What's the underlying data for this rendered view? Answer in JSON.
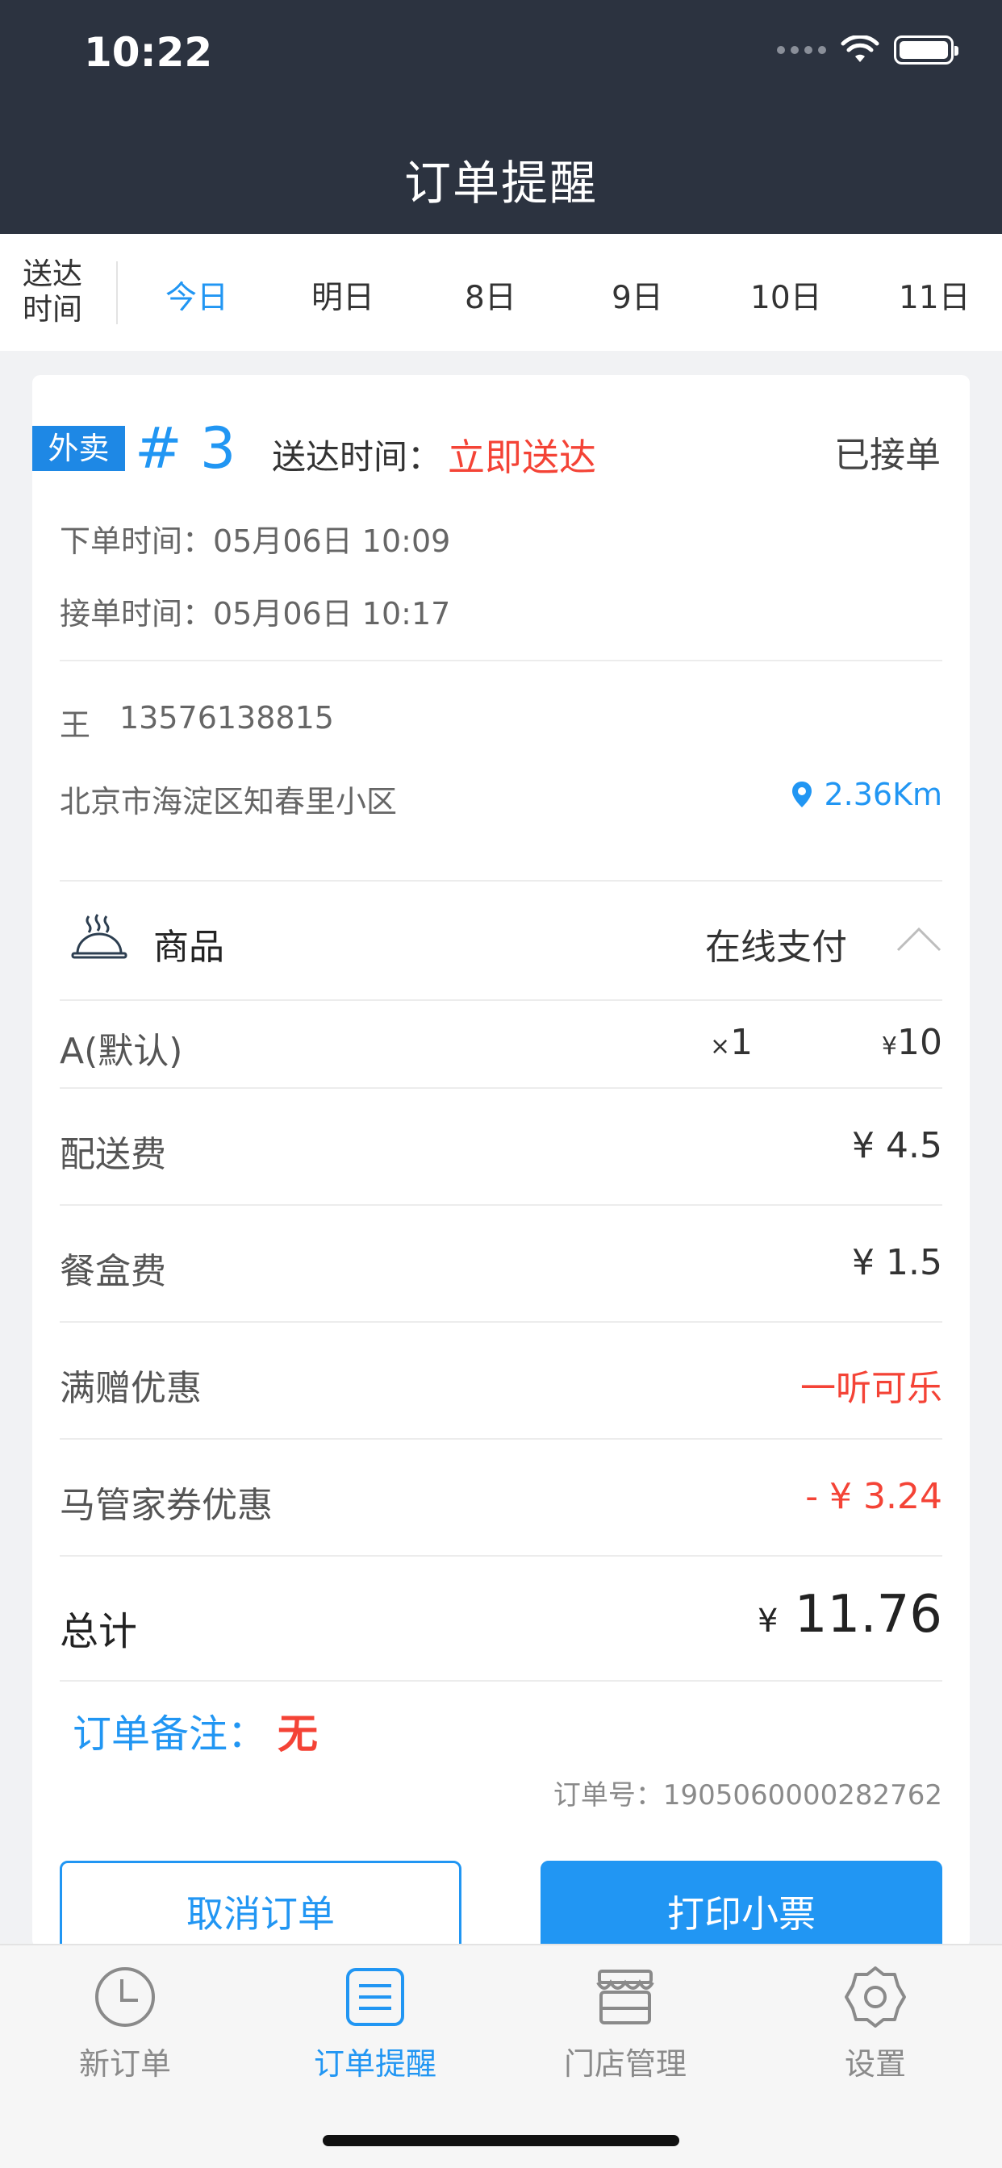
{
  "status_bar": {
    "time": "10:22"
  },
  "header": {
    "title": "订单提醒"
  },
  "date_bar": {
    "label": "送达时间",
    "tabs": [
      "今日",
      "明日",
      "8日",
      "9日",
      "10日",
      "11日"
    ],
    "active_index": 0
  },
  "order": {
    "type_badge": "外卖",
    "number": "# 3",
    "deliver_label": "送达时间：",
    "deliver_value": "立即送达",
    "status": "已接单",
    "placed_time": "下单时间：05月06日 10:09",
    "accepted_time": "接单时间：05月06日 10:17",
    "customer_name": "王",
    "customer_phone": "13576138815",
    "address": "北京市海淀区知春里小区",
    "distance": "2.36Km",
    "goods_title": "商品",
    "payment": "在线支付",
    "item": {
      "name": "A(默认)",
      "qty_prefix": "×",
      "qty": "1",
      "price_symbol": "¥",
      "price": "10"
    },
    "fees": [
      {
        "label": "配送费",
        "value": "¥ 4.5"
      },
      {
        "label": "餐盒费",
        "value": "¥ 1.5"
      },
      {
        "label": "满赠优惠",
        "value": "一听可乐"
      },
      {
        "label": "马管家券优惠",
        "value": "- ¥ 3.24"
      }
    ],
    "total_label": "总计",
    "total_symbol": "¥",
    "total_value": "11.76",
    "note_label": "订单备注：",
    "note_value": "无",
    "order_number": "订单号：1905060000282762",
    "cancel_button": "取消订单",
    "print_button": "打印小票"
  },
  "tabbar": {
    "items": [
      "新订单",
      "订单提醒",
      "门店管理",
      "设置"
    ],
    "active_index": 1
  },
  "colors": {
    "accent": "#2196f3",
    "danger": "#f44336",
    "header_bg": "#2c3340"
  }
}
